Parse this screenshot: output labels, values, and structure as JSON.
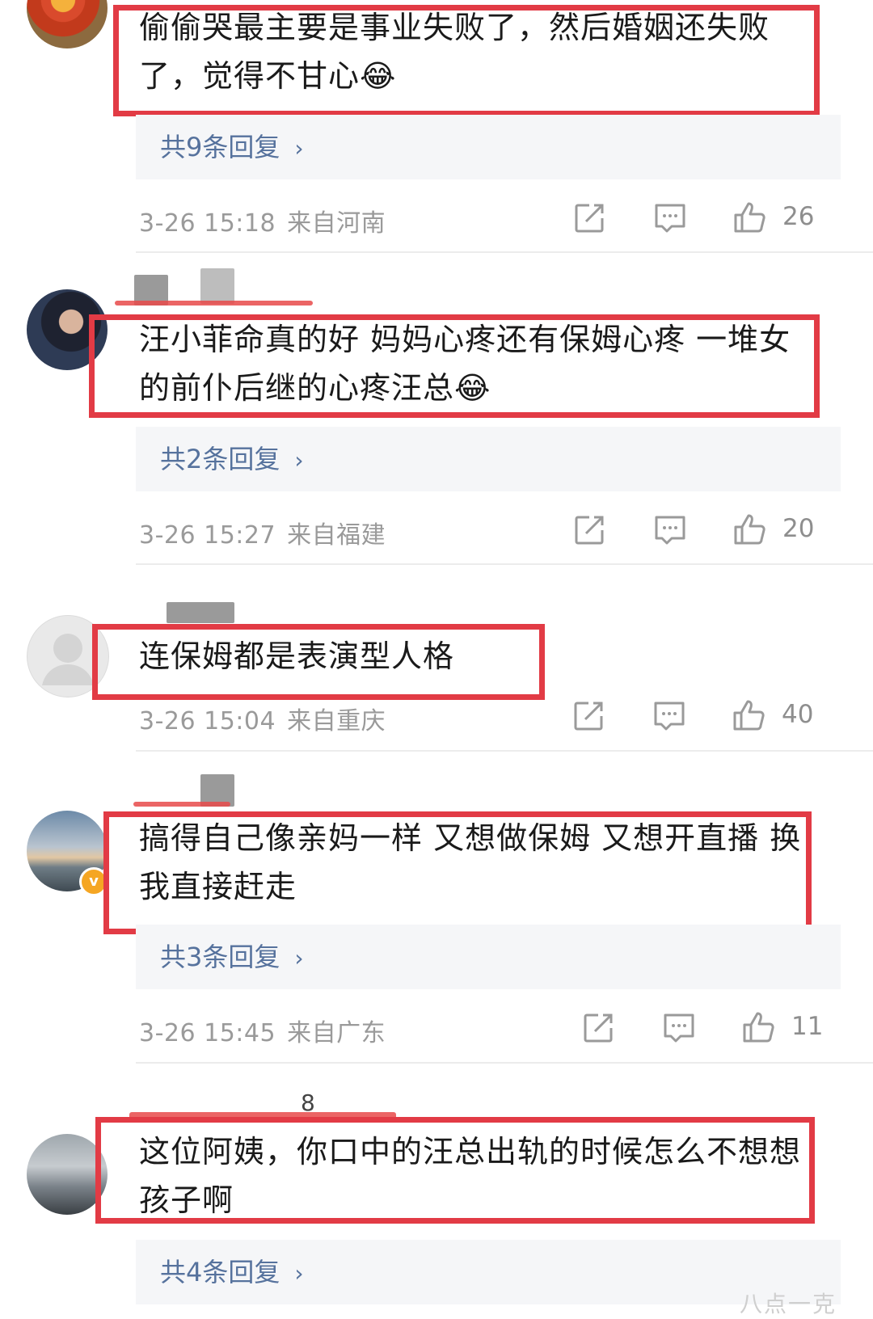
{
  "comments": [
    {
      "text": "偷偷哭最主要是事业失败了，然后婚姻还失败了，觉得不甘心😂",
      "reply": "共9条回复",
      "date": "3-26 15:18",
      "location": "来自河南",
      "likes": "26"
    },
    {
      "text": "汪小菲命真的好 妈妈心疼还有保姆心疼 一堆女的前仆后继的心疼汪总😂",
      "reply": "共2条回复",
      "date": "3-26 15:27",
      "location": "来自福建",
      "likes": "20"
    },
    {
      "text": "连保姆都是表演型人格",
      "date": "3-26 15:04",
      "location": "来自重庆",
      "likes": "40"
    },
    {
      "text": "搞得自己像亲妈一样 又想做保姆 又想开直播 换我直接赶走",
      "reply": "共3条回复",
      "date": "3-26 15:45",
      "location": "来自广东",
      "likes": "11"
    },
    {
      "text": "这位阿姨，你口中的汪总出轨的时候怎么不想想孩子啊",
      "reply": "共4条回复"
    }
  ],
  "usernames": {
    "c4_visible_char": "8"
  },
  "watermark": "八点一克",
  "icons": [
    "share-icon",
    "comment-icon",
    "thumbs-up-icon",
    "verified-badge-icon"
  ],
  "colors": {
    "highlight_box": "#e23b45",
    "reply_link": "#56729d",
    "meta_text": "#9a9a9a"
  }
}
